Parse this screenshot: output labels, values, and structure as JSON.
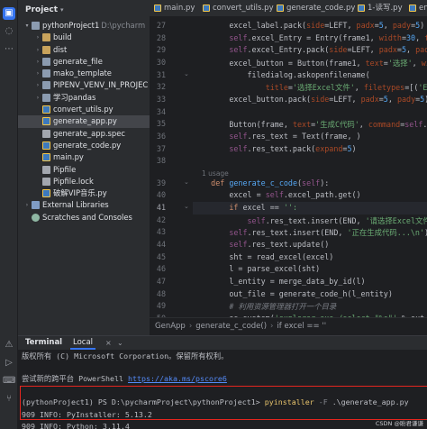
{
  "toolstrip": {
    "top": [
      {
        "icon": "folder-icon",
        "glyph": "▣"
      },
      {
        "icon": "commit-icon",
        "glyph": "◌"
      },
      {
        "icon": "more-icon",
        "glyph": "⋯"
      }
    ],
    "bottom": [
      {
        "icon": "problems-icon",
        "glyph": "⚠"
      },
      {
        "icon": "run-icon",
        "glyph": "▷"
      },
      {
        "icon": "terminal-icon",
        "glyph": "⌨"
      },
      {
        "icon": "git-icon",
        "glyph": "⑂"
      }
    ]
  },
  "project": {
    "title": "Project",
    "tree": [
      {
        "indent": 0,
        "arrow": "▾",
        "icon": "folder",
        "label": "pythonProject1",
        "hint": "D:\\pycharm"
      },
      {
        "indent": 1,
        "arrow": "›",
        "icon": "folder-exc",
        "label": "build"
      },
      {
        "indent": 1,
        "arrow": "›",
        "icon": "folder-exc",
        "label": "dist"
      },
      {
        "indent": 1,
        "arrow": "›",
        "icon": "folder",
        "label": "generate_file"
      },
      {
        "indent": 1,
        "arrow": "›",
        "icon": "folder",
        "label": "mako_template"
      },
      {
        "indent": 1,
        "arrow": "›",
        "icon": "folder",
        "label": "PIPENV_VENV_IN_PROJEC"
      },
      {
        "indent": 1,
        "arrow": "›",
        "icon": "folder",
        "label": "学习pandas"
      },
      {
        "indent": 1,
        "icon": "py",
        "label": "convert_utils.py"
      },
      {
        "indent": 1,
        "icon": "py",
        "label": "generate_app.py",
        "selected": true
      },
      {
        "indent": 1,
        "icon": "file",
        "label": "generate_app.spec"
      },
      {
        "indent": 1,
        "icon": "py",
        "label": "generate_code.py"
      },
      {
        "indent": 1,
        "icon": "py",
        "label": "main.py"
      },
      {
        "indent": 1,
        "icon": "file",
        "label": "Pipfile"
      },
      {
        "indent": 1,
        "icon": "file",
        "label": "Pipfile.lock"
      },
      {
        "indent": 1,
        "icon": "py",
        "label": "破解VIP音乐.py"
      },
      {
        "indent": 0,
        "arrow": "›",
        "icon": "lib",
        "label": "External Libraries"
      },
      {
        "indent": 0,
        "icon": "scratch",
        "label": "Scratches and Consoles"
      }
    ]
  },
  "tabs": [
    {
      "label": "main.py",
      "active": false
    },
    {
      "label": "convert_utils.py",
      "active": false
    },
    {
      "label": "generate_code.py",
      "active": false
    },
    {
      "label": "1-读写.py",
      "active": false
    },
    {
      "label": "ent",
      "active": false
    }
  ],
  "editor": {
    "usages": "1 usage",
    "lines": [
      {
        "n": "27",
        "html": "        excel_label.pack(<span class=\"pn\">side</span>=LEFT, <span class=\"pn\">padx</span>=<span class=\"fn\">5</span>, <span class=\"pn\">pady</span>=<span class=\"fn\">5</span>)"
      },
      {
        "n": "28",
        "html": "        <span class=\"sf\">self</span>.excel_Entry = Entry(frame1, <span class=\"pn\">width</span>=<span class=\"fn\">30</span>, <span class=\"pn\">textva</span>"
      },
      {
        "n": "29",
        "html": "        <span class=\"sf\">self</span>.excel_Entry.pack(<span class=\"pn\">side</span>=LEFT, <span class=\"pn\">padx</span>=<span class=\"fn\">5</span>, <span class=\"pn\">pady</span>=<span class=\"fn\">5</span>)"
      },
      {
        "n": "30",
        "html": "        excel_button = Button(frame1, <span class=\"pn\">text</span>=<span class=\"st\">'选择'</span>, <span class=\"pn\">width</span>"
      },
      {
        "n": "31",
        "html": "            filedialog.askopenfilename("
      },
      {
        "n": "32",
        "html": "                <span class=\"pn\">title</span>=<span class=\"st\">'选择Excel文件'</span>, <span class=\"pn\">filetypes</span>=[(<span class=\"st\">'Excel</span>"
      },
      {
        "n": "33",
        "html": "        excel_button.pack(<span class=\"pn\">side</span>=LEFT, <span class=\"pn\">padx</span>=<span class=\"fn\">5</span>, <span class=\"pn\">pady</span>=<span class=\"fn\">5</span>)"
      },
      {
        "n": "34",
        "html": ""
      },
      {
        "n": "35",
        "html": "        Button(frame, <span class=\"pn\">text</span>=<span class=\"st\">'生成C代码'</span>, <span class=\"pn\">command</span>=<span class=\"sf\">self</span>.gener"
      },
      {
        "n": "36",
        "html": "        <span class=\"sf\">self</span>.res_text = Text(frame, )"
      },
      {
        "n": "37",
        "html": "        <span class=\"sf\">self</span>.res_text.pack(<span class=\"pn\">expand</span>=<span class=\"fn\">5</span>)"
      },
      {
        "n": "38",
        "html": ""
      },
      {
        "n": "39",
        "usage": true,
        "html": "    <span class=\"kw\">def</span> <span class=\"fn\">generate_c_code</span>(<span class=\"sf\">self</span>):"
      },
      {
        "n": "40",
        "html": "        excel = <span class=\"sf\">self</span>.excel_path.get()"
      },
      {
        "n": "41",
        "current": true,
        "html": "        <span class=\"kw\">if</span> excel == <span class=\"st\">'':</span>"
      },
      {
        "n": "42",
        "html": "            <span class=\"sf\">self</span>.res_text.insert(END, <span class=\"st\">'请选择Excel文件 \\n'</span>"
      },
      {
        "n": "43",
        "html": "        <span class=\"sf\">self</span>.res_text.insert(END, <span class=\"st\">'正在生成代码...\\n'</span>)"
      },
      {
        "n": "44",
        "html": "        <span class=\"sf\">self</span>.res_text.update()"
      },
      {
        "n": "45",
        "html": "        sht = read_excel(excel)"
      },
      {
        "n": "46",
        "html": "        l = parse_excel(sht)"
      },
      {
        "n": "47",
        "html": "        l_entity = merge_data_by_id(l)"
      },
      {
        "n": "48",
        "html": "        out_file = generate_code_h(l_entity)"
      },
      {
        "n": "49",
        "html": "        <span class=\"cm\"># 利用资源管理器打开一个目录</span>"
      },
      {
        "n": "50",
        "html": "        os.system(<span class=\"st\">'explorer.exe /select,\"%s\"'</span> % out_file"
      }
    ]
  },
  "breadcrumb": [
    "GenApp",
    "generate_c_code()",
    "if excel == ''"
  ],
  "terminal": {
    "title": "Terminal",
    "tab": "Local",
    "close": "×",
    "more": "⌄",
    "lines": [
      {
        "text": "版权所有 (C) Microsoft Corporation。保留所有权利。"
      },
      {
        "text": ""
      },
      {
        "pre": "尝试新的跨平台 PowerShell ",
        "link": "https://aka.ms/pscore6"
      },
      {
        "text": ""
      },
      {
        "prompt": "(pythonProject1) PS D:\\pycharmProject\\pythonProject1> ",
        "cmd": "pyinstaller",
        "flag": " -F ",
        "arg": ".\\generate_app.py"
      },
      {
        "text": "909 INFO: PyInstaller: 5.13.2"
      },
      {
        "text": "909 INFO: Python: 3.11.4"
      }
    ]
  },
  "watermark": "CSDN @盼君谦谦"
}
